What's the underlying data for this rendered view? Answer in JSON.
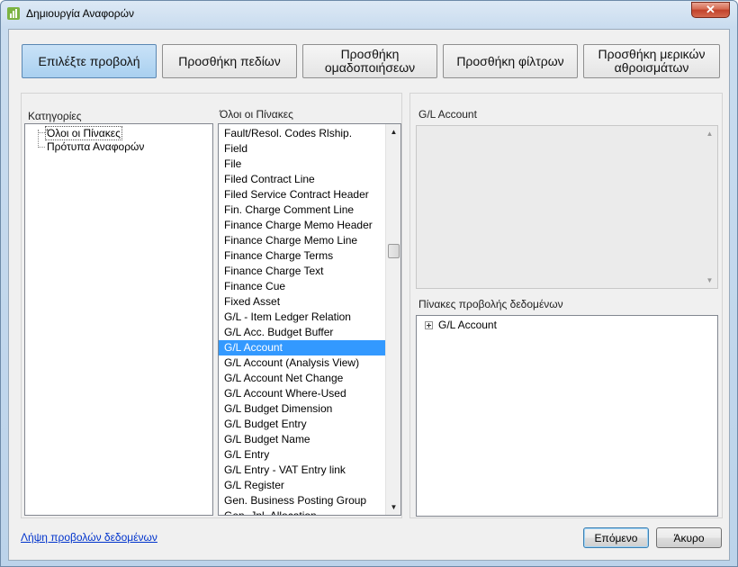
{
  "window": {
    "title": "Δημιουργία Αναφορών",
    "close_label": "✕"
  },
  "steps": [
    {
      "label": "Επιλέξτε προβολή",
      "active": true
    },
    {
      "label": "Προσθήκη πεδίων",
      "active": false
    },
    {
      "label": "Προσθήκη ομαδοποιήσεων",
      "active": false
    },
    {
      "label": "Προσθήκη φίλτρων",
      "active": false
    },
    {
      "label": "Προσθήκη μερικών αθροισμάτων",
      "active": false
    }
  ],
  "categories": {
    "label": "Κατηγορίες",
    "items": [
      "Όλοι οι Πίνακες",
      "Πρότυπα Αναφορών"
    ],
    "selected": "Όλοι οι Πίνακες"
  },
  "tables": {
    "label": "Όλοι οι Πίνακες",
    "items": [
      "Fault/Resol. Codes Rlship.",
      "Field",
      "File",
      "Filed Contract Line",
      "Filed Service Contract Header",
      "Fin. Charge Comment Line",
      "Finance Charge Memo Header",
      "Finance Charge Memo Line",
      "Finance Charge Terms",
      "Finance Charge Text",
      "Finance Cue",
      "Fixed Asset",
      "G/L - Item Ledger Relation",
      "G/L Acc. Budget Buffer",
      "G/L Account",
      "G/L Account (Analysis View)",
      "G/L Account Net Change",
      "G/L Account Where-Used",
      "G/L Budget Dimension",
      "G/L Budget Entry",
      "G/L Budget Name",
      "G/L Entry",
      "G/L Entry - VAT Entry link",
      "G/L Register",
      "Gen. Business Posting Group",
      "Gen. Jnl. Allocation"
    ],
    "selected_index": 14
  },
  "right_panel": {
    "title": "G/L Account",
    "views_label": "Πίνακες προβολής δεδομένων",
    "views": [
      "G/L Account"
    ]
  },
  "footer": {
    "link_label": "Λήψη προβολών δεδομένων",
    "next_label": "Επόμενο",
    "cancel_label": "Άκυρο"
  },
  "colors": {
    "selection": "#3399ff",
    "active_step": "#b8d9f3",
    "link": "#0033cc"
  }
}
